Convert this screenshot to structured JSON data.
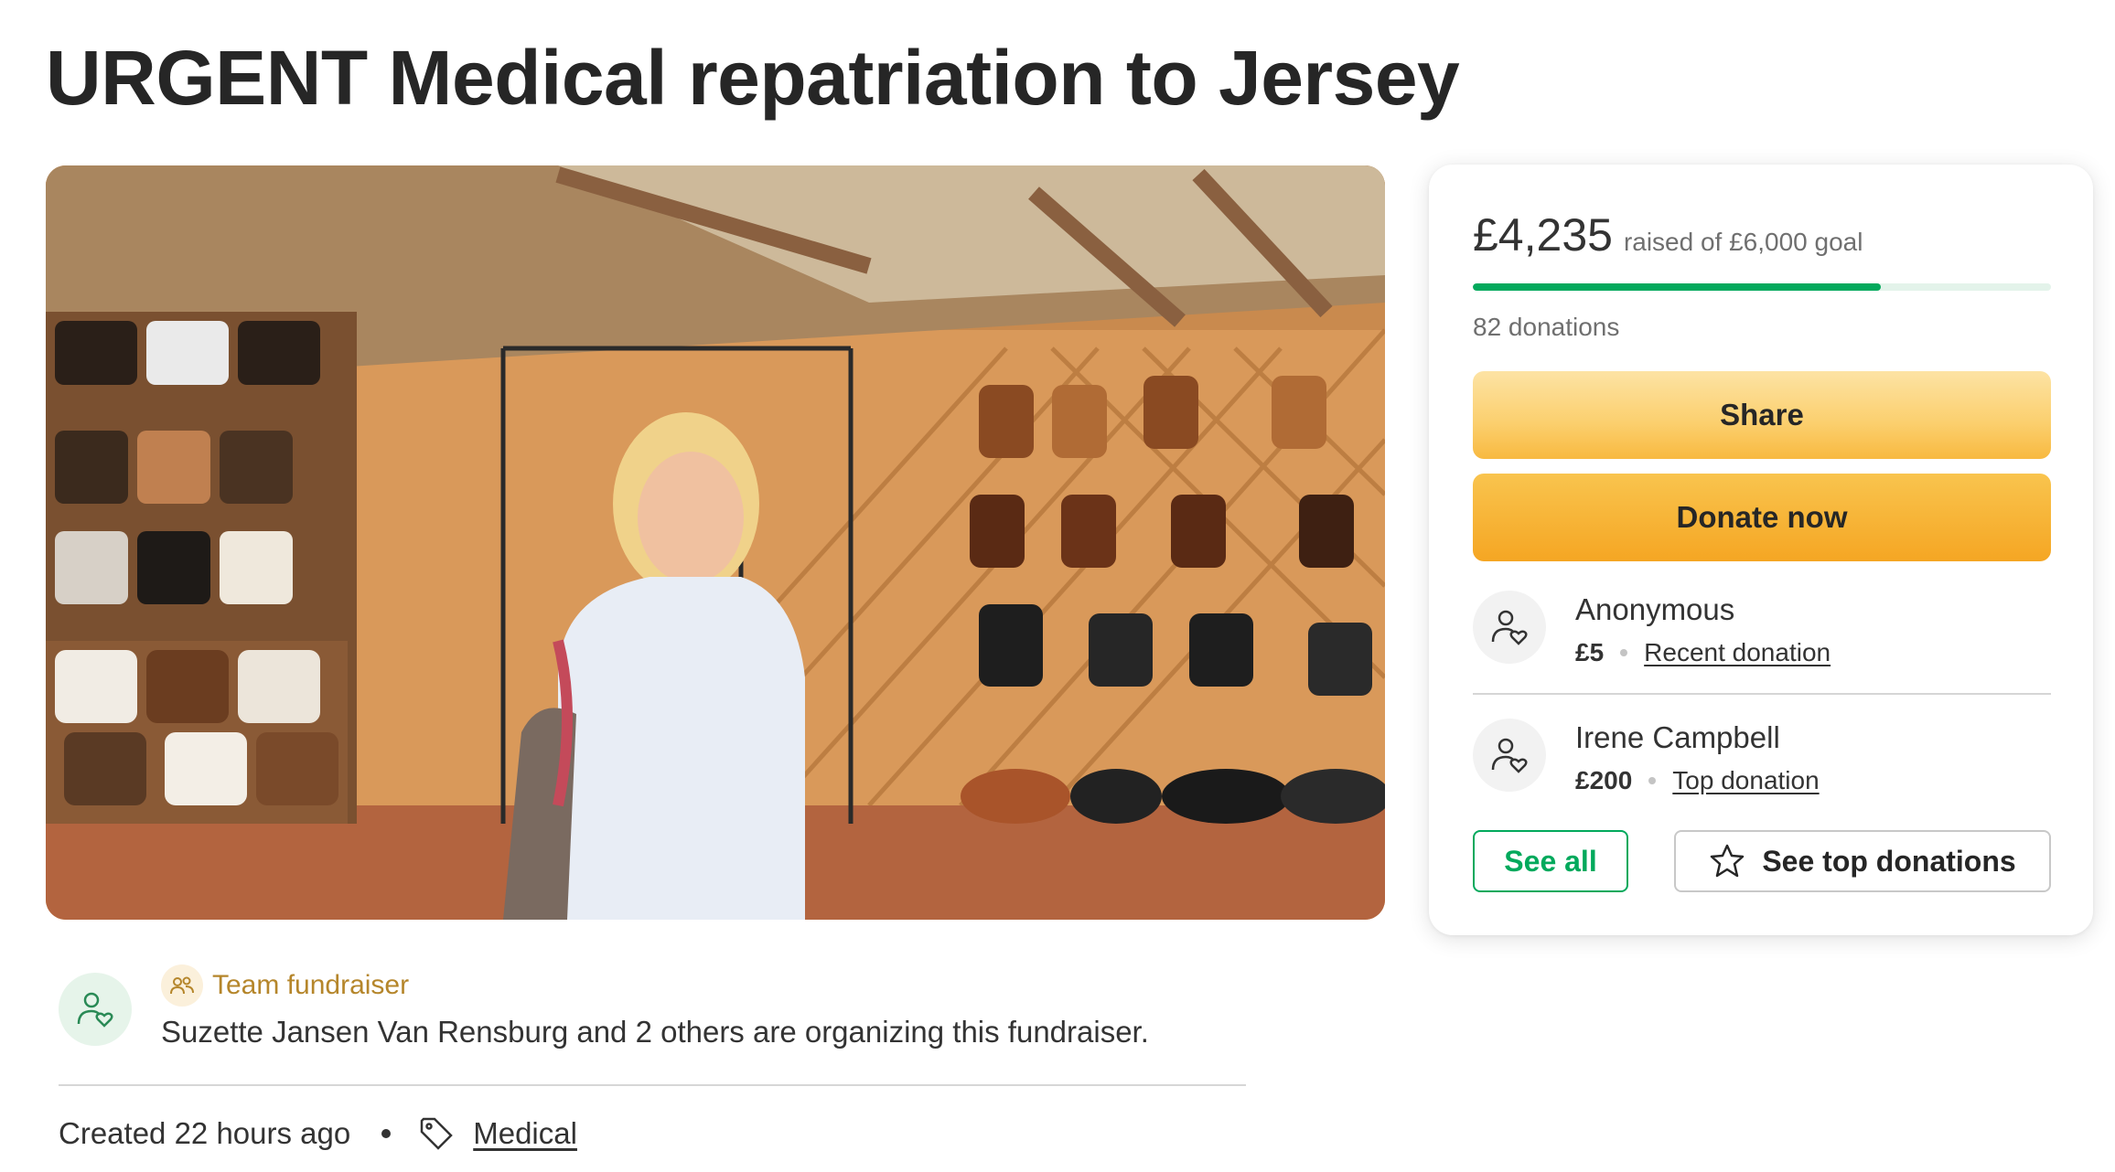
{
  "page": {
    "title": "URGENT Medical repatriation to Jersey"
  },
  "hero": {
    "icon": "photo-of-woman-in-leather-goods-shop"
  },
  "organizer": {
    "team_label": "Team fundraiser",
    "text": "Suzette Jansen Van Rensburg and 2 others are organizing this fundraiser.",
    "avatar_icon": "person-heart-icon",
    "team_icon": "people-icon"
  },
  "meta": {
    "created": "Created 22 hours ago",
    "category": "Medical",
    "tag_icon": "tag-icon"
  },
  "donation_card": {
    "raised": "£4,235",
    "goal_text": "raised of £6,000 goal",
    "progress": 0.706,
    "donations_count": "82 donations",
    "share_label": "Share",
    "donate_label": "Donate now",
    "donors": [
      {
        "name": "Anonymous",
        "amount": "£5",
        "type": "Recent donation"
      },
      {
        "name": "Irene Campbell",
        "amount": "£200",
        "type": "Top donation"
      }
    ],
    "see_all_label": "See all",
    "see_top_label": "See top donations",
    "colors": {
      "progress": "#02a95c",
      "progress_track": "#e3f3ea",
      "donate": "#f5a623",
      "share": "#fbcf6d",
      "accent_green": "#02a95c"
    }
  }
}
